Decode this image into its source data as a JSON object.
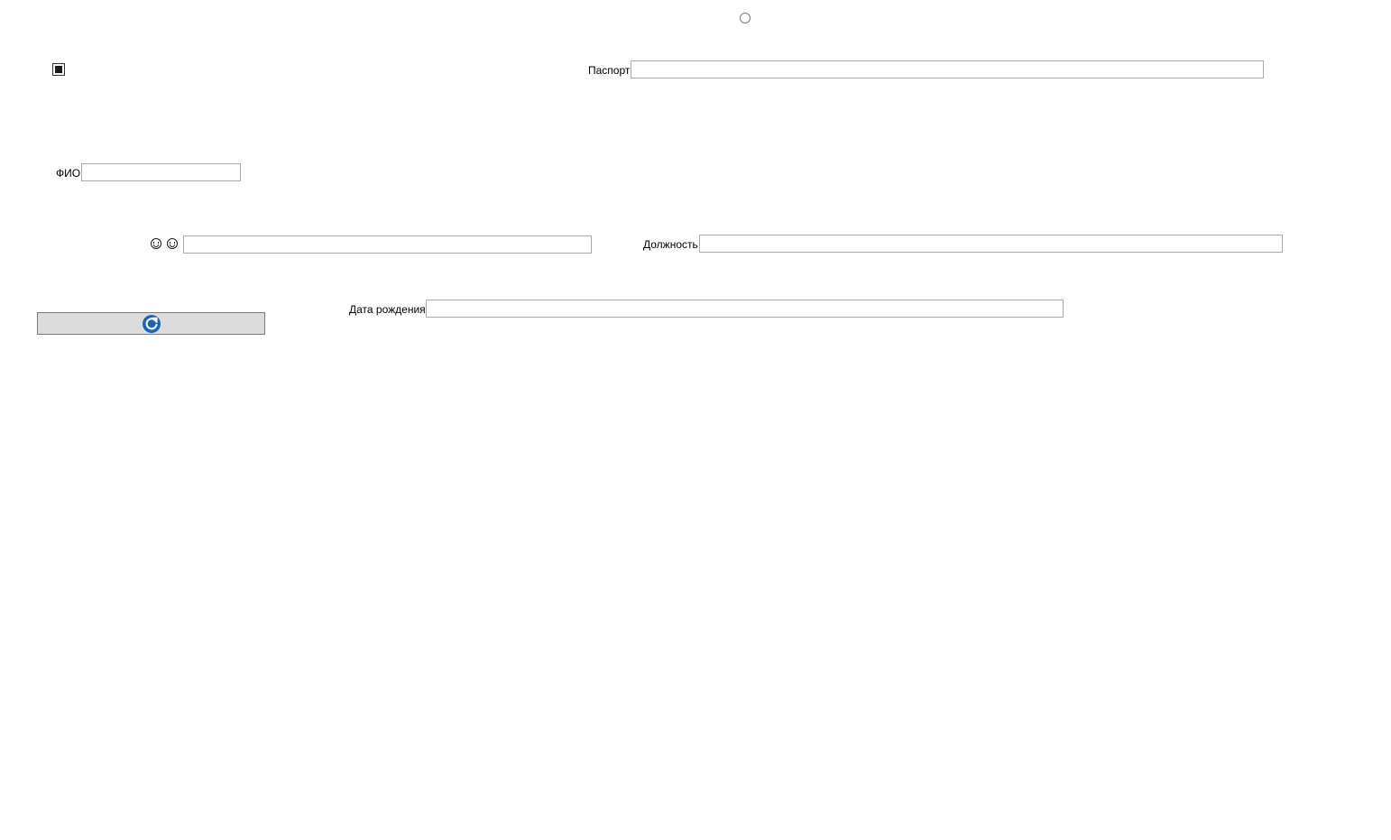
{
  "form": {
    "passport_label": "Паспорт",
    "passport_value": "",
    "fio_label": "ФИО",
    "fio_value": "",
    "emoji_value": "",
    "position_label": "Должность",
    "position_value": "",
    "birthdate_label": "Дата рождения",
    "birthdate_value": ""
  },
  "icons": {
    "emoji_1": "smiley-icon",
    "emoji_2": "smiley-icon",
    "refresh_button": "refresh-icon"
  },
  "colors": {
    "refresh_icon": "#1565c0",
    "button_bg": "#dcdcdc",
    "field_border": "#ababab"
  }
}
